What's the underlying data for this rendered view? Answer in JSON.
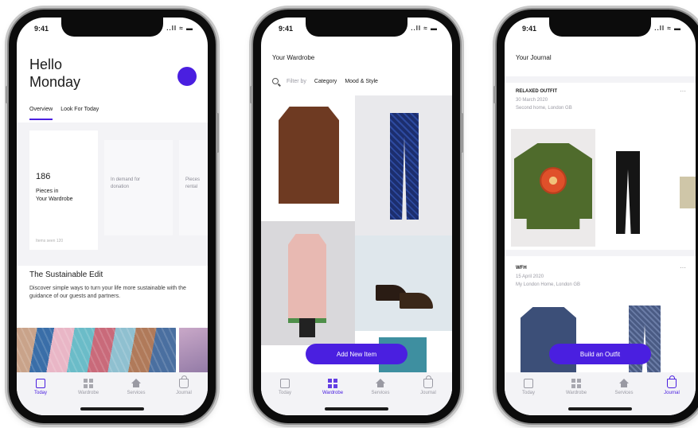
{
  "accent_color": "#4a1fe0",
  "status": {
    "time": "9:41",
    "signal": "..ll ≈ ▬"
  },
  "tabs": [
    {
      "label": "Today",
      "icon": "today-icon"
    },
    {
      "label": "Wardrobe",
      "icon": "wardrobe-grid-icon"
    },
    {
      "label": "Services",
      "icon": "services-home-icon"
    },
    {
      "label": "Journal",
      "icon": "journal-bag-icon"
    }
  ],
  "phone1": {
    "greeting_line1": "Hello",
    "greeting_line2": "Monday",
    "tabs": [
      "Overview",
      "Look For Today"
    ],
    "card1": {
      "number": "186",
      "label_line1": "Pieces in",
      "label_line2": "Your Wardrobe",
      "footer": "Items seen 120"
    },
    "card2": {
      "label_line1": "In demand for",
      "label_line2": "donation"
    },
    "card3": {
      "label_line1": "Pieces",
      "label_line2": "rental"
    },
    "section_title": "The Sustainable Edit",
    "section_text": "Discover simple ways to turn your life more sustainable with the guidance of our guests and partners."
  },
  "phone2": {
    "title": "Your Wardrobe",
    "filter_by": "Filter by",
    "filter_category": "Category",
    "filter_mood": "Mood & Style",
    "cta": "Add New Item"
  },
  "phone3": {
    "title": "Your Journal",
    "entry1": {
      "title": "RELAXED OUTFIT",
      "date": "30 March 2020",
      "place": "Second home, London GB"
    },
    "entry2": {
      "title": "WFH",
      "date": "15 April 2020",
      "place": "My London Home, London GB"
    },
    "more": "···",
    "cta": "Build an Outfit"
  }
}
